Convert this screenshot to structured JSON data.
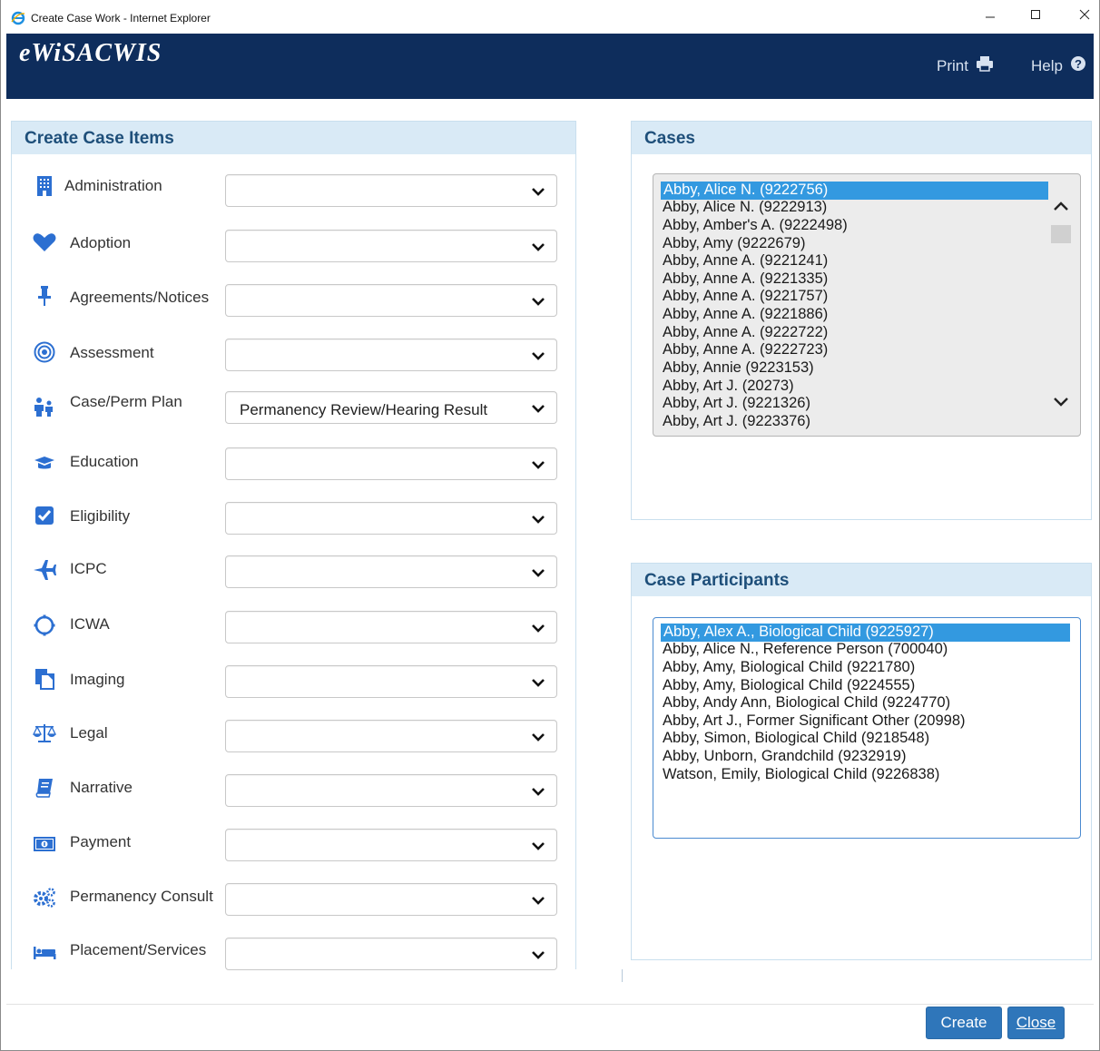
{
  "window": {
    "title": "Create Case Work - Internet Explorer",
    "icons": {
      "app": "internet-explorer-icon",
      "minimize": "minimize-icon",
      "maximize": "maximize-icon",
      "close": "close-icon"
    }
  },
  "header": {
    "brand": "eWiSACWIS",
    "print_label": "Print",
    "help_label": "Help",
    "colors": {
      "background": "#0e2d5c",
      "text": "#ffffff"
    }
  },
  "create_case_items": {
    "title": "Create Case Items",
    "items": [
      {
        "label": "Administration",
        "icon": "building-icon",
        "value": ""
      },
      {
        "label": "Adoption",
        "icon": "heart-icon",
        "value": ""
      },
      {
        "label": "Agreements/Notices",
        "icon": "pushpin-icon",
        "value": ""
      },
      {
        "label": "Assessment",
        "icon": "target-icon",
        "value": ""
      },
      {
        "label": "Case/Perm Plan",
        "icon": "family-icon",
        "value": "Permanency Review/Hearing Result"
      },
      {
        "label": "Education",
        "icon": "graduation-cap-icon",
        "value": ""
      },
      {
        "label": "Eligibility",
        "icon": "checkbox-icon",
        "value": ""
      },
      {
        "label": "ICPC",
        "icon": "airplane-icon",
        "value": ""
      },
      {
        "label": "ICWA",
        "icon": "circle-o-icon",
        "value": ""
      },
      {
        "label": "Imaging",
        "icon": "copy-icon",
        "value": ""
      },
      {
        "label": "Legal",
        "icon": "scales-icon",
        "value": ""
      },
      {
        "label": "Narrative",
        "icon": "book-icon",
        "value": ""
      },
      {
        "label": "Payment",
        "icon": "money-icon",
        "value": ""
      },
      {
        "label": "Permanency Consult",
        "icon": "cogs-icon",
        "value": ""
      },
      {
        "label": "Placement/Services",
        "icon": "bed-icon",
        "value": ""
      }
    ]
  },
  "cases": {
    "title": "Cases",
    "items": [
      "Abby, Alice N. (9222756)",
      "Abby, Alice N. (9222913)",
      "Abby, Amber's A. (9222498)",
      "Abby, Amy (9222679)",
      "Abby, Anne A. (9221241)",
      "Abby, Anne A. (9221335)",
      "Abby, Anne A. (9221757)",
      "Abby, Anne A. (9221886)",
      "Abby, Anne A. (9222722)",
      "Abby, Anne A. (9222723)",
      "Abby, Annie (9223153)",
      "Abby, Art J. (20273)",
      "Abby, Art J. (9221326)",
      "Abby, Art J. (9223376)"
    ],
    "selected_index": 0,
    "scroll_icons": {
      "up": "chevron-up-icon",
      "down": "chevron-down-icon"
    }
  },
  "case_participants": {
    "title": "Case Participants",
    "items": [
      "Abby, Alex A., Biological Child (9225927)",
      "Abby, Alice N., Reference Person (700040)",
      "Abby, Amy, Biological Child (9221780)",
      "Abby, Amy, Biological Child (9224555)",
      "Abby, Andy Ann, Biological Child (9224770)",
      "Abby, Art J., Former Significant Other (20998)",
      "Abby, Simon, Biological Child (9218548)",
      "Abby, Unborn, Grandchild (9232919)",
      "Watson, Emily, Biological Child (9226838)"
    ],
    "selected_index": 0
  },
  "footer": {
    "create_label": "Create",
    "close_label": "Close"
  },
  "colors": {
    "accent": "#2f76ba",
    "selection": "#3399e0",
    "panel_header": "#d9eaf6",
    "panel_title": "#1e4f7a"
  }
}
